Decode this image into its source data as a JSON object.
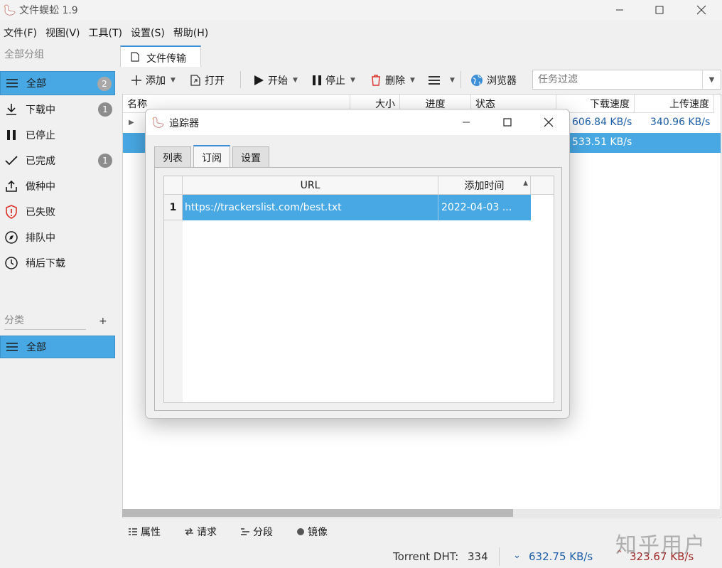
{
  "window": {
    "title": "文件蜈蚣 1.9"
  },
  "menu": [
    "文件(F)",
    "视图(V)",
    "工具(T)",
    "设置(S)",
    "帮助(H)"
  ],
  "sidebar": {
    "group_header": "全部分组",
    "items": [
      {
        "label": "全部",
        "icon": "list-icon",
        "badge": "2",
        "active": true
      },
      {
        "label": "下载中",
        "icon": "download-icon",
        "badge": "1"
      },
      {
        "label": "已停止",
        "icon": "pause-icon",
        "badge": ""
      },
      {
        "label": "已完成",
        "icon": "check-icon",
        "badge": "1"
      },
      {
        "label": "做种中",
        "icon": "upload-icon",
        "badge": ""
      },
      {
        "label": "已失败",
        "icon": "shield-alert-icon",
        "badge": ""
      },
      {
        "label": "排队中",
        "icon": "compass-icon",
        "badge": ""
      },
      {
        "label": "稍后下载",
        "icon": "clock-icon",
        "badge": ""
      }
    ],
    "category_header": "分类",
    "category_add": "+",
    "category_items": [
      {
        "label": "全部",
        "icon": "list-icon",
        "active": true
      }
    ]
  },
  "main": {
    "tab_label": "文件传输",
    "toolbar": {
      "add": "添加",
      "open": "打开",
      "start": "开始",
      "stop": "停止",
      "delete": "删除",
      "browser": "浏览器",
      "filter_placeholder": "任务过滤"
    },
    "columns": [
      "名称",
      "大小",
      "进度",
      "状态",
      "下载速度",
      "上传速度"
    ],
    "rows": [
      {
        "download_speed": "606.84 KB/s",
        "upload_speed": "340.96 KB/s",
        "selected": false
      },
      {
        "download_speed": "533.51 KB/s",
        "upload_speed": "",
        "selected": true
      }
    ],
    "bottom_tabs": [
      {
        "label": "属性",
        "icon": "properties-icon"
      },
      {
        "label": "请求",
        "icon": "request-icon"
      },
      {
        "label": "分段",
        "icon": "segments-icon"
      },
      {
        "label": "镜像",
        "icon": "mirror-icon"
      }
    ]
  },
  "status": {
    "dht_label": "Torrent DHT:",
    "dht_value": "334",
    "down_speed": "632.75 KB/s",
    "up_speed": "323.67 KB/s",
    "watermark": "知乎用户"
  },
  "dialog": {
    "title": "追踪器",
    "tabs": [
      "列表",
      "订阅",
      "设置"
    ],
    "active_tab": "订阅",
    "columns": [
      "URL",
      "添加时间"
    ],
    "rows": [
      {
        "num": "1",
        "url": "https://trackerslist.com/best.txt",
        "time": "2022-04-03 ..."
      }
    ]
  },
  "colors": {
    "accent": "#48a8e3",
    "speed_text": "#1d5fa8"
  }
}
